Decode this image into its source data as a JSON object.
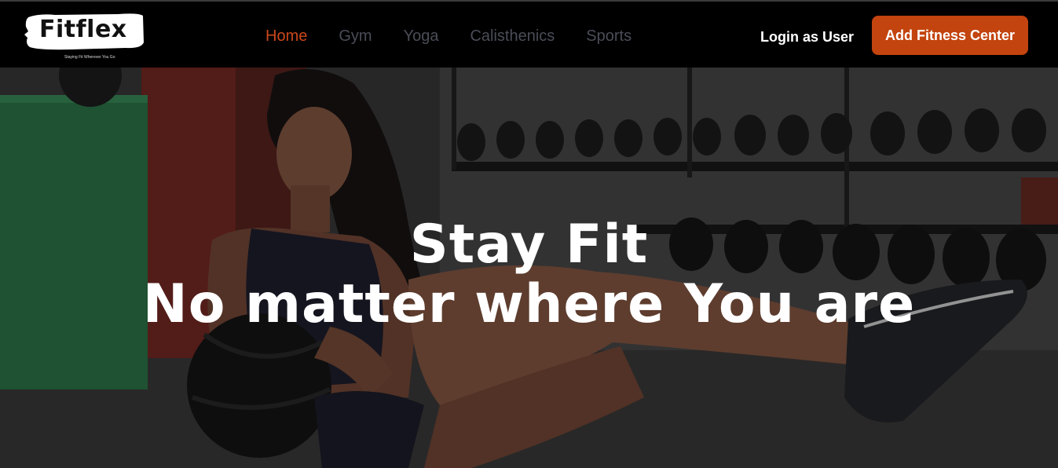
{
  "brand": {
    "name": "Fitflex",
    "tagline": "Staying Fit Wherever You Go"
  },
  "nav": {
    "items": [
      {
        "label": "Home",
        "active": true
      },
      {
        "label": "Gym",
        "active": false
      },
      {
        "label": "Yoga",
        "active": false
      },
      {
        "label": "Calisthenics",
        "active": false
      },
      {
        "label": "Sports",
        "active": false
      }
    ]
  },
  "header": {
    "login_label": "Login as User",
    "cta_label": "Add Fitness Center"
  },
  "hero": {
    "title_line1": "Stay Fit",
    "title_line2": "No matter where You are"
  },
  "colors": {
    "accent": "#c3440f",
    "nav_active": "#c9481b",
    "nav_inactive": "#4a4d57",
    "header_bg": "#000000"
  }
}
